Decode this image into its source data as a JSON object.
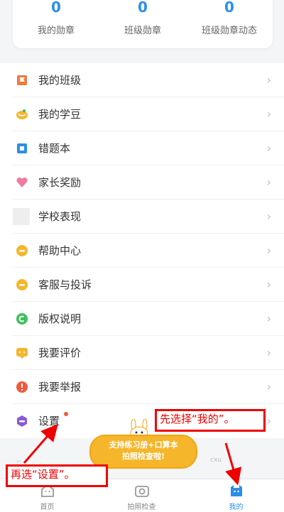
{
  "stats": [
    {
      "value": "0",
      "label": "我的勋章"
    },
    {
      "value": "0",
      "label": "班级勋章"
    },
    {
      "value": "0",
      "label": "班级勋章动态"
    }
  ],
  "menu": [
    {
      "label": "我的班级",
      "icon": "flag-icon",
      "color": "#f07a3c"
    },
    {
      "label": "我的学豆",
      "icon": "coin-icon",
      "color": "#f5b62b"
    },
    {
      "label": "错题本",
      "icon": "notebook-icon",
      "color": "#2b8fe8"
    },
    {
      "label": "家长奖励",
      "icon": "heart-icon",
      "color": "#f07aa0"
    },
    {
      "label": "学校表现",
      "icon": "school-icon",
      "color": "#e8e8e8"
    },
    {
      "label": "帮助中心",
      "icon": "help-icon",
      "color": "#f5b62b"
    },
    {
      "label": "客服与投诉",
      "icon": "service-icon",
      "color": "#f5b62b"
    },
    {
      "label": "版权说明",
      "icon": "copyright-icon",
      "color": "#3cbf5a"
    },
    {
      "label": "我要评价",
      "icon": "comment-icon",
      "color": "#f5b62b"
    },
    {
      "label": "我要举报",
      "icon": "report-icon",
      "color": "#f05a3a"
    },
    {
      "label": "设置",
      "icon": "settings-icon",
      "color": "#8a5ad6"
    }
  ],
  "promo": {
    "line1": "支持练习册+口算本",
    "line2": "拍照检查啦!"
  },
  "footer_fragment": "cxu",
  "tabs": [
    {
      "label": "首页",
      "icon": "home-icon"
    },
    {
      "label": "拍照检查",
      "icon": "camera-icon"
    },
    {
      "label": "我的",
      "icon": "profile-icon",
      "active": true
    }
  ],
  "annotations": {
    "first": "先选择“我的”。",
    "second": "再选“设置”。"
  },
  "colors": {
    "accent": "#2b8fe8",
    "annotation": "#e00000",
    "promo": "#f5b62b"
  }
}
